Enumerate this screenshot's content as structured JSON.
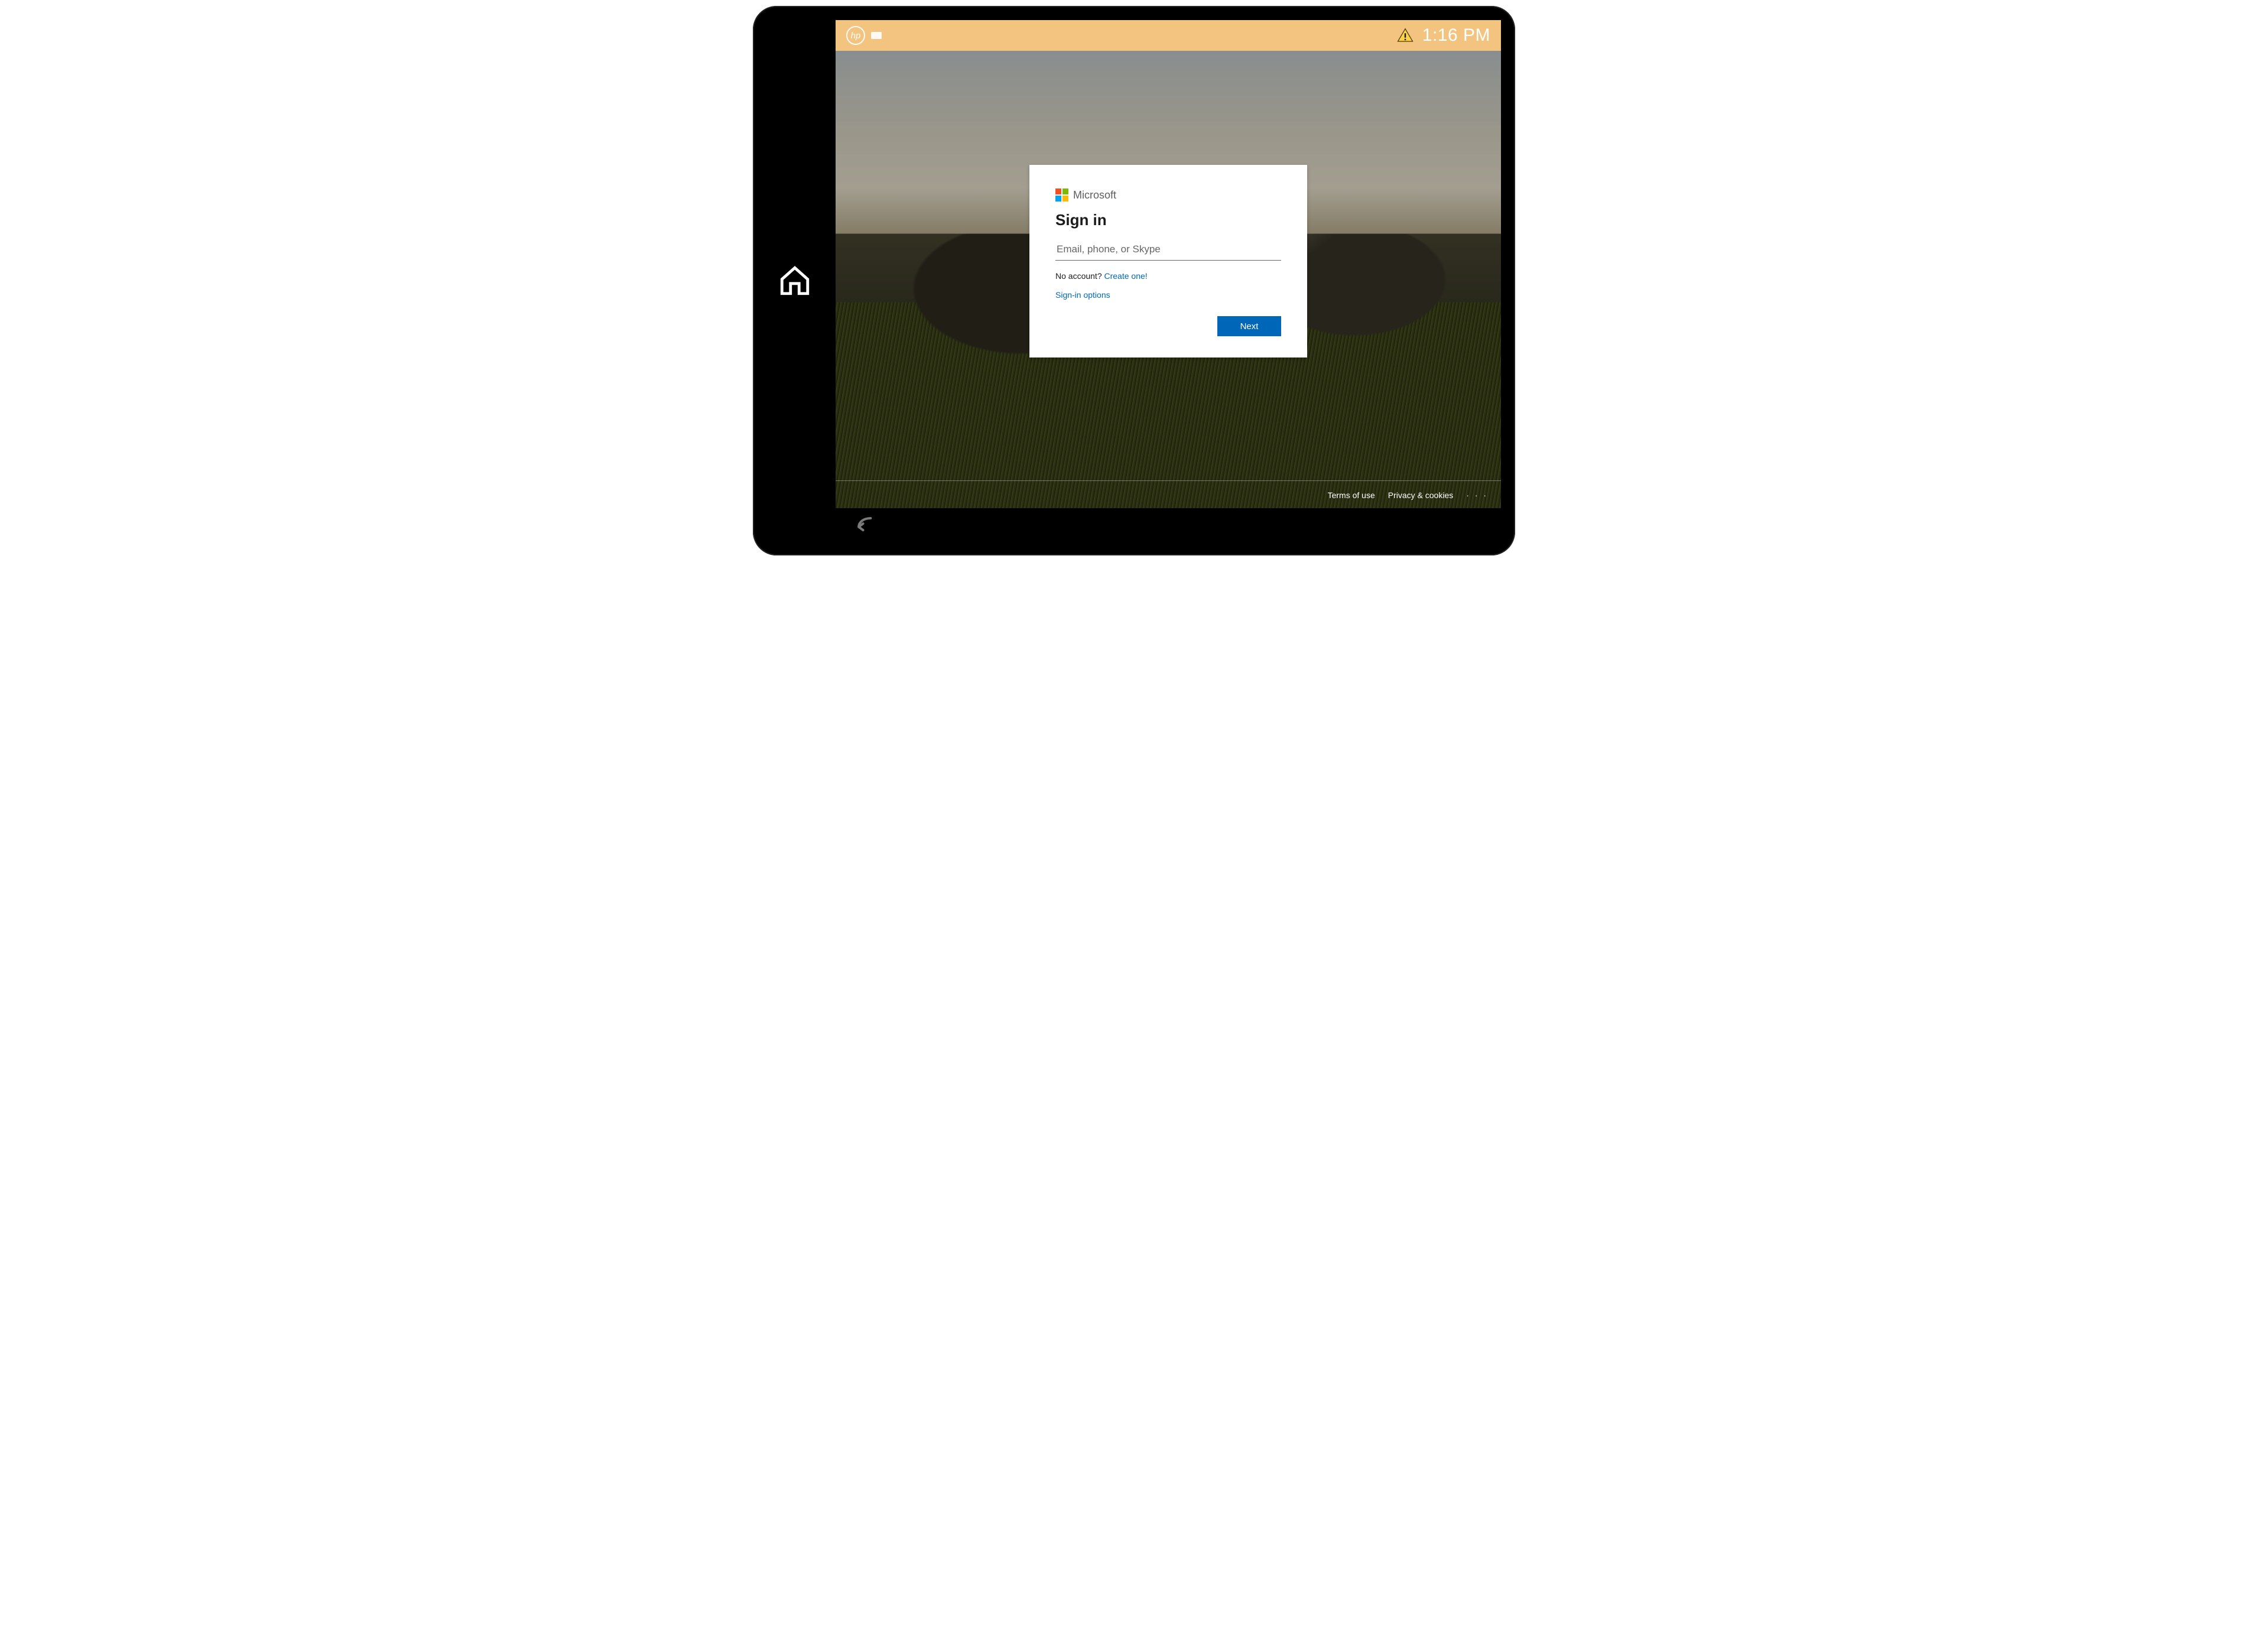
{
  "statusbar": {
    "hp_label": "hp",
    "time": "1:16 PM"
  },
  "signin": {
    "brand": "Microsoft",
    "heading": "Sign in",
    "input_placeholder": "Email, phone, or Skype",
    "no_account_prefix": "No account? ",
    "create_one": "Create one!",
    "signin_options": "Sign-in options",
    "next": "Next"
  },
  "footer": {
    "terms": "Terms of use",
    "privacy": "Privacy & cookies",
    "more": "· · ·"
  }
}
